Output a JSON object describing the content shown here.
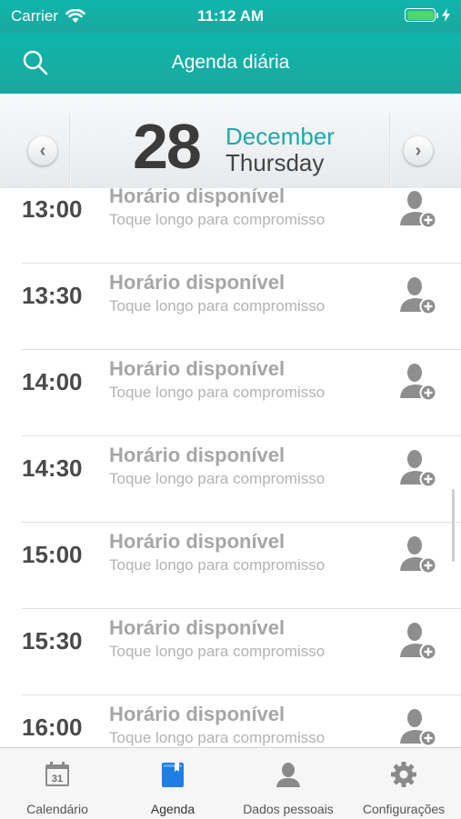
{
  "status_bar": {
    "carrier": "Carrier",
    "time": "11:12 AM",
    "battery_color": "#4cd964"
  },
  "nav": {
    "title": "Agenda diária",
    "search_icon": "search-icon"
  },
  "date": {
    "day": "28",
    "month": "December",
    "weekday": "Thursday",
    "prev_glyph": "‹",
    "next_glyph": "›"
  },
  "slots": [
    {
      "time": "13:00",
      "status": "Horário disponível",
      "hint": "Toque longo para compromisso"
    },
    {
      "time": "13:30",
      "status": "Horário disponível",
      "hint": "Toque longo para compromisso"
    },
    {
      "time": "14:00",
      "status": "Horário disponível",
      "hint": "Toque longo para compromisso"
    },
    {
      "time": "14:30",
      "status": "Horário disponível",
      "hint": "Toque longo para compromisso"
    },
    {
      "time": "15:00",
      "status": "Horário disponível",
      "hint": "Toque longo para compromisso"
    },
    {
      "time": "15:30",
      "status": "Horário disponível",
      "hint": "Toque longo para compromisso"
    },
    {
      "time": "16:00",
      "status": "Horário disponível",
      "hint": "Toque longo para compromisso"
    }
  ],
  "tabs": [
    {
      "label": "Calendário",
      "icon": "calendar-icon",
      "icon_text": "31"
    },
    {
      "label": "Agenda",
      "icon": "book-icon",
      "active": true
    },
    {
      "label": "Dados pessoais",
      "icon": "person-icon"
    },
    {
      "label": "Configurações",
      "icon": "gear-icon"
    }
  ],
  "colors": {
    "header": "#13afa5",
    "month": "#1fa8a8",
    "active_tab": "#1e7ee6"
  }
}
